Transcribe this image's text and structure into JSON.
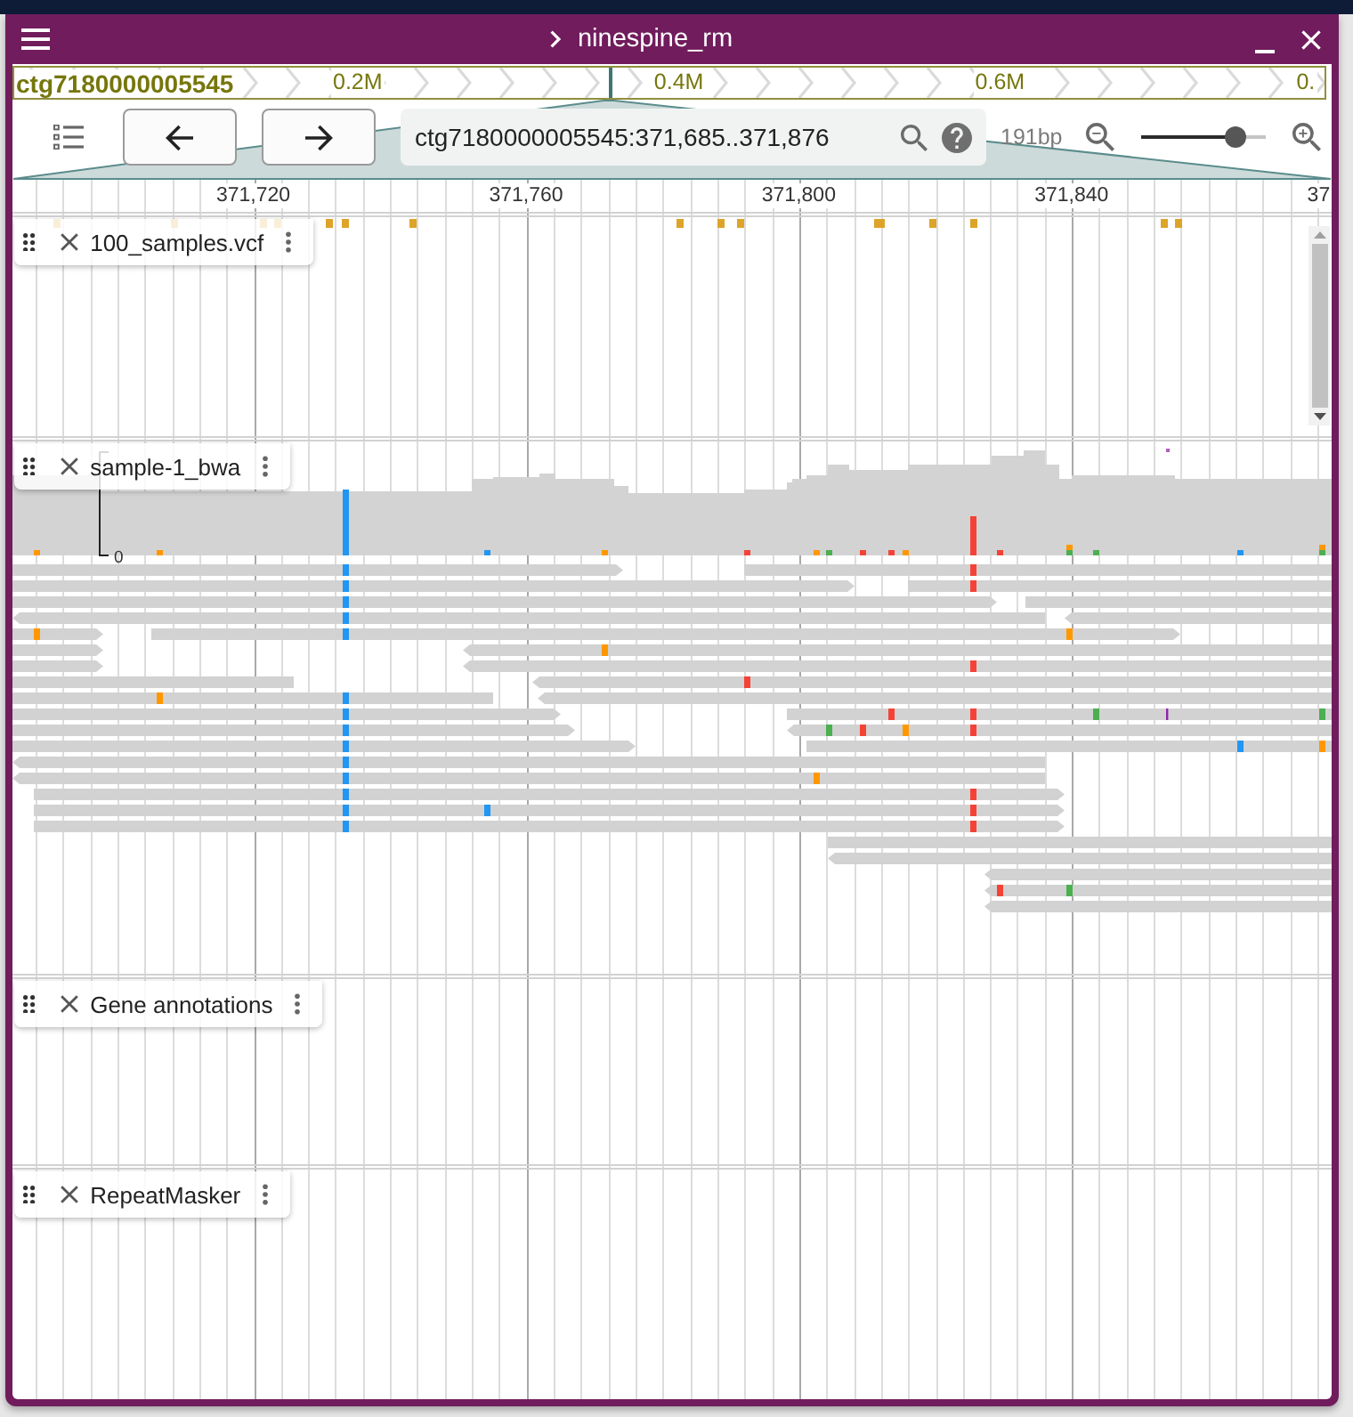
{
  "window": {
    "title": "ninespine_rm"
  },
  "overview": {
    "contig": "ctg7180000005545",
    "ticks": [
      "0.2M",
      "0.4M",
      "0.6M",
      "0."
    ]
  },
  "toolbar": {
    "location": "ctg7180000005545:371,685..371,876",
    "span": "191bp",
    "zoom": {
      "level": 0.76
    }
  },
  "ruler": {
    "ticks": [
      "371,720",
      "371,760",
      "371,800",
      "371,840",
      "37"
    ]
  },
  "tracks": [
    {
      "kind": "variants",
      "name": "100_samples.vcf"
    },
    {
      "kind": "alignments",
      "name": "sample-1_bwa",
      "coverage_scale": {
        "min": "0"
      }
    },
    {
      "kind": "features",
      "name": "Gene annotations"
    },
    {
      "kind": "features",
      "name": "RepeatMasker"
    }
  ]
}
